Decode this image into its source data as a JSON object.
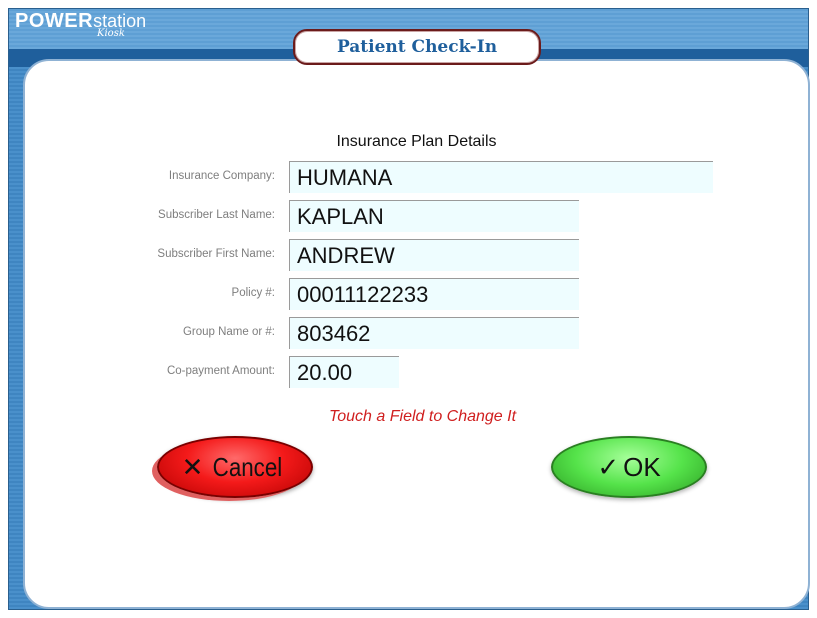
{
  "brand": {
    "power": "POWER",
    "station": "station",
    "kiosk": "Kiosk"
  },
  "header": {
    "title": "Patient Check-In"
  },
  "form": {
    "section_title": "Insurance Plan Details",
    "fields": [
      {
        "label": "Insurance Company:",
        "value": "HUMANA"
      },
      {
        "label": "Subscriber Last Name:",
        "value": "KAPLAN"
      },
      {
        "label": "Subscriber First Name:",
        "value": "ANDREW"
      },
      {
        "label": "Policy #:",
        "value": "00011122233"
      },
      {
        "label": "Group Name or #:",
        "value": "803462"
      },
      {
        "label": "Co-payment Amount:",
        "value": "20.00"
      }
    ],
    "hint": "Touch a Field to Change It"
  },
  "buttons": {
    "cancel_icon": "✕",
    "cancel_label": "Cancel",
    "ok_icon": "✓",
    "ok_label": "OK"
  },
  "colors": {
    "accent_blue": "#1f5f9c",
    "hint_red": "#d02020",
    "cancel_red": "#f41a1a",
    "ok_green": "#55e34a",
    "field_bg": "#eefdff"
  }
}
